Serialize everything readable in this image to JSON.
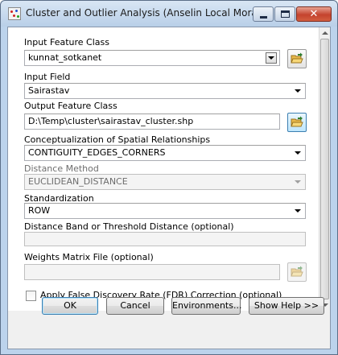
{
  "window": {
    "title": "Cluster and Outlier Analysis (Anselin Local Morans I)",
    "close_glyph": "✕"
  },
  "params": {
    "input_feature_class": {
      "label": "Input Feature Class",
      "value": "kunnat_sotkanet"
    },
    "input_field": {
      "label": "Input Field",
      "value": "Sairastav"
    },
    "output_feature_class": {
      "label": "Output Feature Class",
      "value": "D:\\Temp\\cluster\\sairastav_cluster.shp"
    },
    "conceptualization": {
      "label": "Conceptualization of Spatial Relationships",
      "value": "CONTIGUITY_EDGES_CORNERS"
    },
    "distance_method": {
      "label": "Distance Method",
      "value": "EUCLIDEAN_DISTANCE"
    },
    "standardization": {
      "label": "Standardization",
      "value": "ROW"
    },
    "distance_band": {
      "label": "Distance Band or Threshold Distance (optional)",
      "value": ""
    },
    "weights_matrix": {
      "label": "Weights Matrix File (optional)",
      "value": ""
    },
    "fdr": {
      "label": "Apply False Discovery Rate (FDR) Correction (optional)",
      "checked": false
    }
  },
  "buttons": {
    "ok": "OK",
    "cancel": "Cancel",
    "environments": "Environments...",
    "show_help": "Show Help >>"
  },
  "colors": {
    "title_bar": "#bcd3ec",
    "close_button": "#c4432e",
    "folder_icon": "#e8b84a",
    "default_button_border": "#3c7fb1"
  },
  "icons": [
    "app-icon",
    "minimize-icon",
    "maximize-icon",
    "close-icon",
    "open-folder-icon",
    "chevron-down-icon",
    "scroll-up-icon",
    "scroll-down-icon"
  ]
}
